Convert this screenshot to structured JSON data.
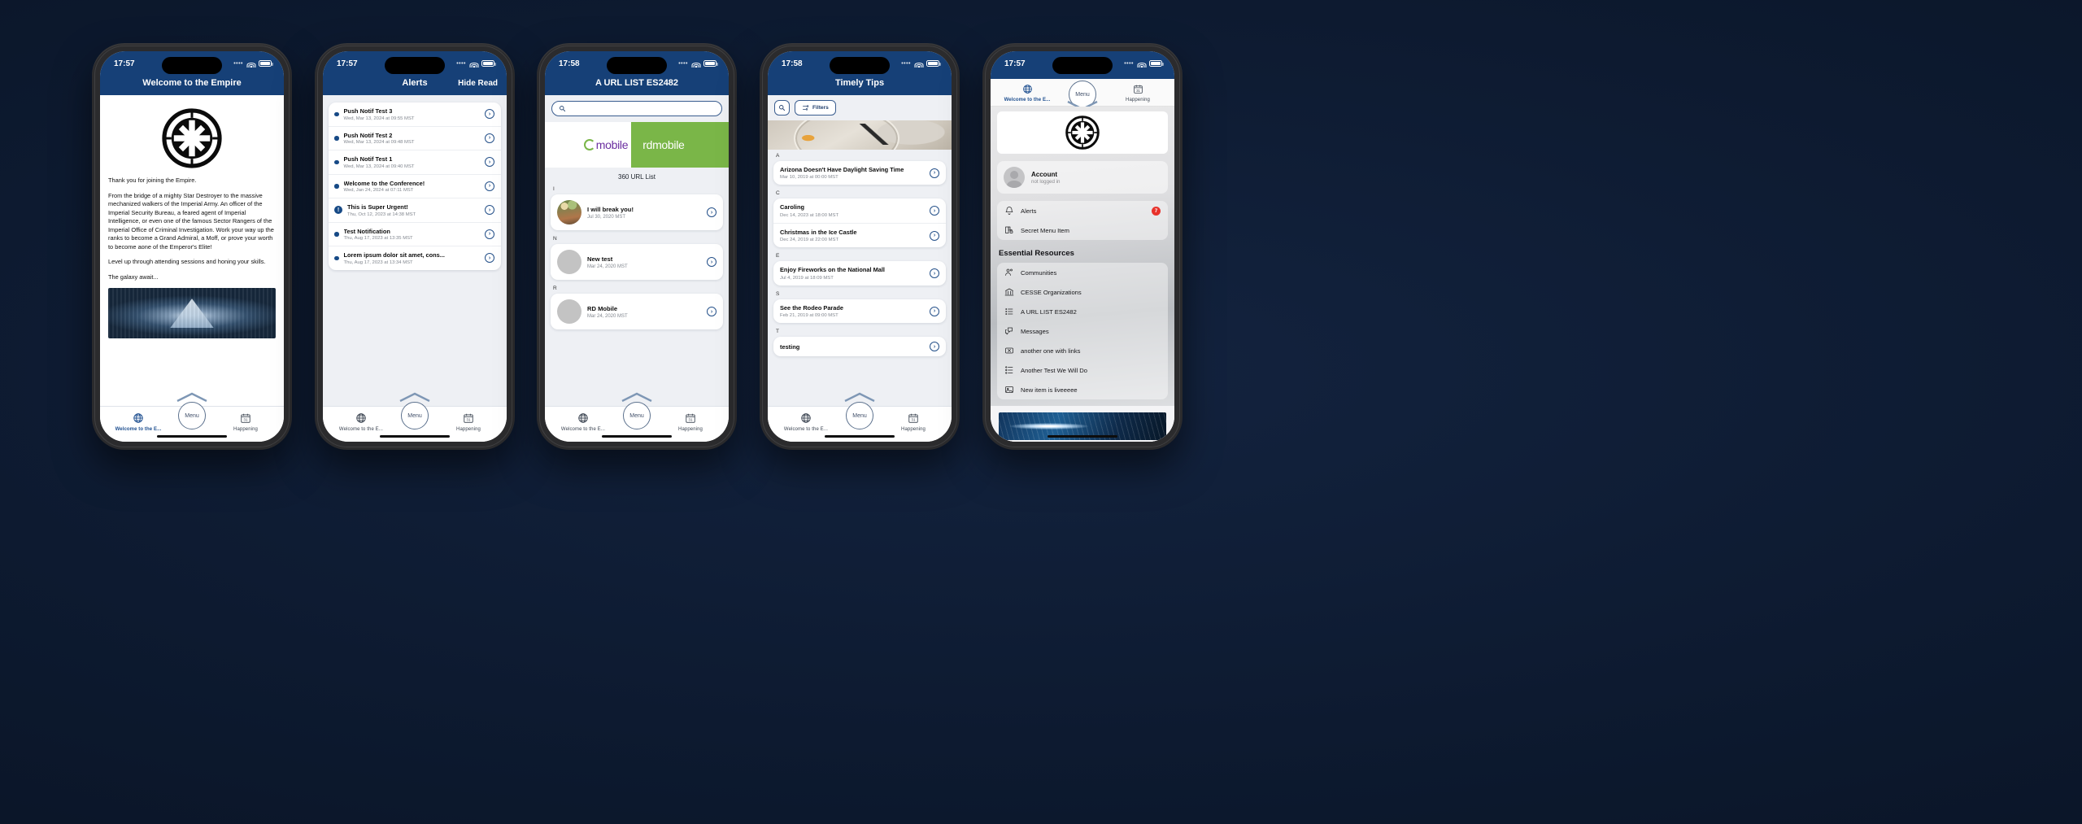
{
  "background_color": "#0d1a30",
  "brand": {
    "nav_blue": "#164077",
    "accent_blue": "#245089",
    "badge_red": "#e8322b",
    "green": "#7ab648",
    "purple": "#6b2fa0"
  },
  "tabbar": {
    "left_label": "Welcome to the E...",
    "left_icon": "globe-icon",
    "center_label": "Menu",
    "right_label": "Happening",
    "right_icon": "calendar-31-icon"
  },
  "phones": [
    {
      "id": "welcome",
      "status_time": "17:57",
      "nav_title": "Welcome to the Empire",
      "crest_icon": "imperial-crest-icon",
      "paragraphs": [
        "Thank you for joining the Empire.",
        "From the bridge of a mighty Star Destroyer to the massive mechanized walkers of the Imperial Army. An officer of the Imperial Security Bureau, a feared agent of Imperial Intelligence, or even one of the famous Sector Rangers of the Imperial Office of Criminal Investigation. Work your way up the ranks to become a Grand Admiral, a Moff, or prove your worth to become aone of the Emperor's Elite!",
        "Level up through attending sessions and honing your skills.",
        "The galaxy await..."
      ],
      "hero_image_alt": "star-destroyer-hangar-image"
    },
    {
      "id": "alerts",
      "status_time": "17:57",
      "nav_title": "Alerts",
      "nav_action": "Hide Read",
      "items": [
        {
          "title": "Push Notif Test 3",
          "date": "Wed, Mar 13, 2024 at 09:55 MST",
          "marker": "dot"
        },
        {
          "title": "Push Notif Test 2",
          "date": "Wed, Mar 13, 2024 at 09:48 MST",
          "marker": "dot"
        },
        {
          "title": "Push Notif Test 1",
          "date": "Wed, Mar 13, 2024 at 09:40 MST",
          "marker": "dot"
        },
        {
          "title": "Welcome to the Conference!",
          "date": "Wed, Jan 24, 2024 at 07:11 MST",
          "marker": "dot"
        },
        {
          "title": "This is Super Urgent!",
          "date": "Thu, Oct 12, 2023 at 14:38 MST",
          "marker": "urgent"
        },
        {
          "title": "Test Notification",
          "date": "Thu, Aug 17, 2023 at 13:35 MST",
          "marker": "dot"
        },
        {
          "title": "Lorem ipsum dolor sit amet, cons...",
          "date": "Thu, Aug 17, 2023 at 13:34 MST",
          "marker": "dot"
        }
      ]
    },
    {
      "id": "url-list",
      "status_time": "17:58",
      "nav_title": "A URL LIST ES2482",
      "search_placeholder": "",
      "banner": {
        "left_word": "mobile",
        "right_word": "rdmobile"
      },
      "sublabel": "360 URL List",
      "sections": [
        {
          "letter": "I",
          "items": [
            {
              "title": "I will break you!",
              "date": "Jul 30, 2020 MST",
              "avatar": "photo"
            }
          ]
        },
        {
          "letter": "N",
          "items": [
            {
              "title": "New test",
              "date": "Mar 24, 2020 MST",
              "avatar": "placeholder"
            }
          ]
        },
        {
          "letter": "R",
          "items": [
            {
              "title": "RD Mobile",
              "date": "Mar 24, 2020 MST",
              "avatar": "placeholder"
            }
          ]
        }
      ]
    },
    {
      "id": "timely-tips",
      "status_time": "17:58",
      "nav_title": "Timely Tips",
      "search_icon": "magnifier-icon",
      "filters_label": "Filters",
      "hero_image_alt": "clock-face-image",
      "sections": [
        {
          "letter": "A",
          "items": [
            {
              "title": "Arizona Doesn't Have Daylight Saving Time",
              "date": "Mar 10, 2019 at 00:00 MST"
            }
          ]
        },
        {
          "letter": "C",
          "items": [
            {
              "title": "Caroling",
              "date": "Dec 14, 2023 at 18:00 MST"
            },
            {
              "title": "Christmas in the Ice Castle",
              "date": "Dec 24, 2019 at 22:00 MST"
            }
          ]
        },
        {
          "letter": "E",
          "items": [
            {
              "title": "Enjoy Fireworks on the National Mall",
              "date": "Jul 4, 2019 at 18:09 MST"
            }
          ]
        },
        {
          "letter": "S",
          "items": [
            {
              "title": "See the Rodeo Parade",
              "date": "Feb 21, 2019 at 09:00 MST"
            }
          ]
        },
        {
          "letter": "T",
          "items": [
            {
              "title": "testing",
              "date": ""
            }
          ]
        }
      ]
    },
    {
      "id": "menu-drawer",
      "status_time": "17:57",
      "logo_icon": "imperial-crest-icon",
      "account": {
        "name": "Account",
        "status": "not logged in",
        "avatar": "person-avatar-icon"
      },
      "primary_items": [
        {
          "label": "Alerts",
          "icon": "bell-icon",
          "badge": "7"
        },
        {
          "label": "Secret Menu Item",
          "icon": "book-lock-icon",
          "badge": ""
        }
      ],
      "section_heading": "Essential Resources",
      "resource_items": [
        {
          "label": "Communities",
          "icon": "people-icon"
        },
        {
          "label": "CESSE Organizations",
          "icon": "bank-icon"
        },
        {
          "label": "A URL LIST ES2482",
          "icon": "list-icon"
        },
        {
          "label": "Messages",
          "icon": "chat-bubbles-icon"
        },
        {
          "label": "another one with links",
          "icon": "ticket-icon"
        },
        {
          "label": "Another Test We Will Do",
          "icon": "bullet-list-icon"
        },
        {
          "label": "New item is liveeeee",
          "icon": "image-icon"
        }
      ],
      "hero_image_alt": "hyperspace-image"
    }
  ]
}
